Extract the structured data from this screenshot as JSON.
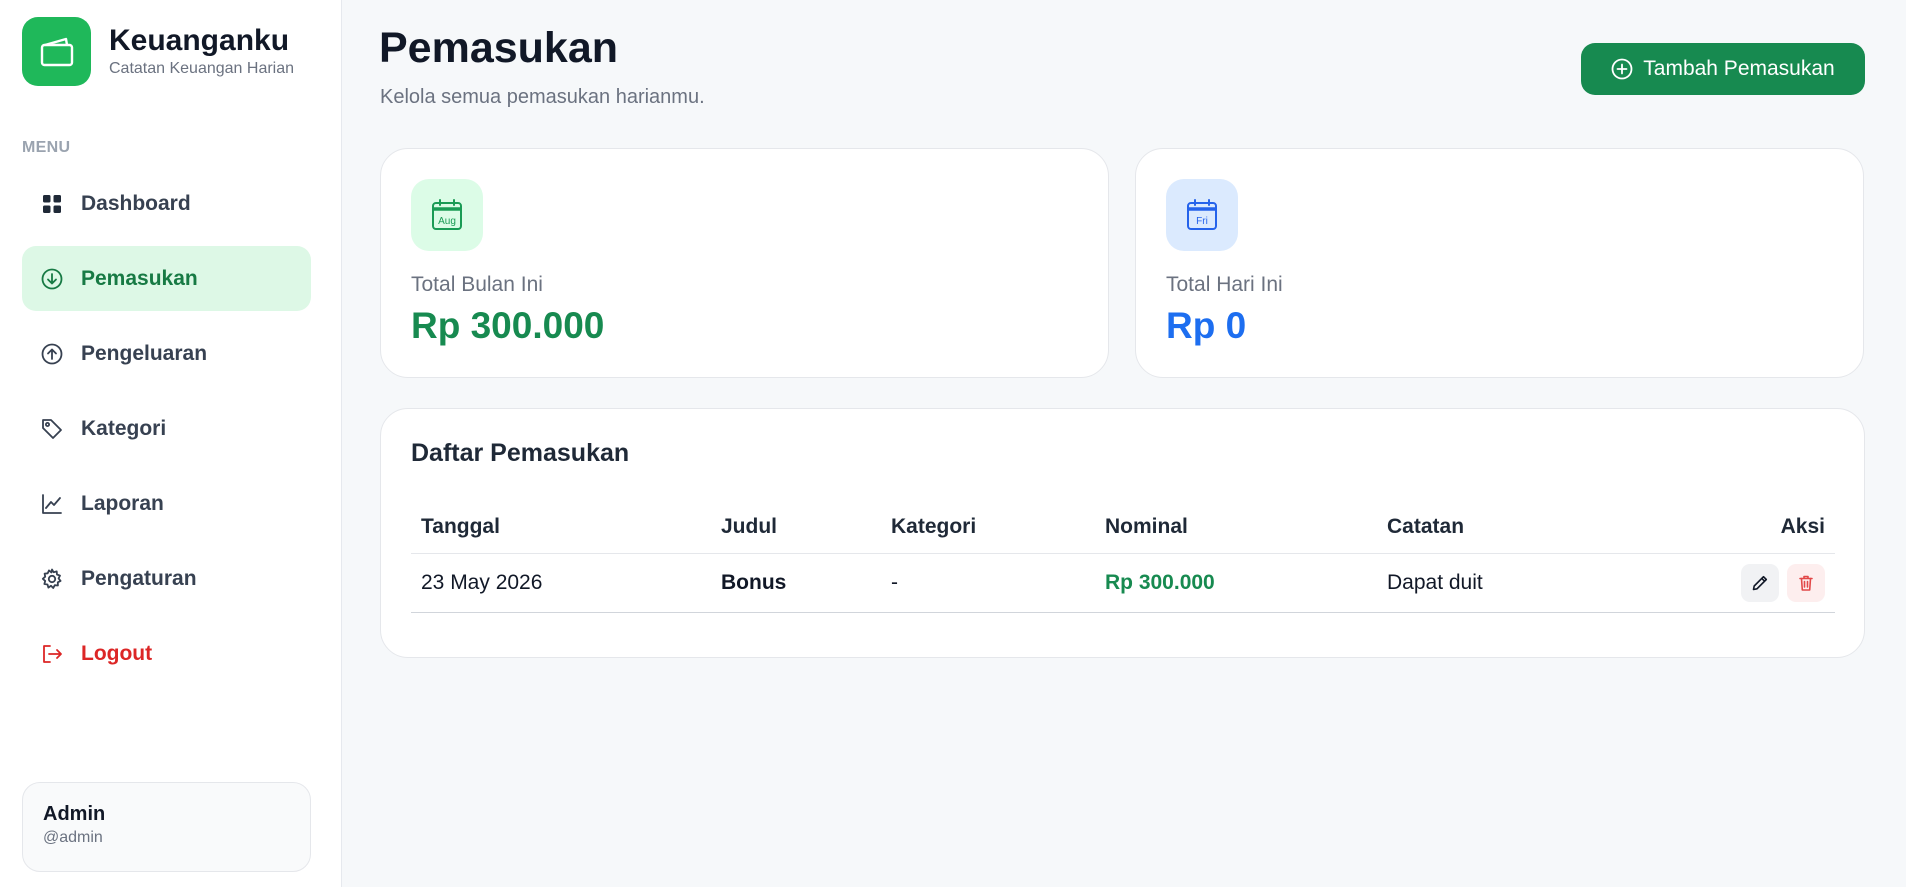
{
  "app": {
    "name": "Keuanganku",
    "tagline": "Catatan Keuangan Harian"
  },
  "sidebar": {
    "menu_heading": "MENU",
    "items": [
      {
        "label": "Dashboard",
        "icon": "grid-icon"
      },
      {
        "label": "Pemasukan",
        "icon": "arrow-down-circle-icon",
        "active": true
      },
      {
        "label": "Pengeluaran",
        "icon": "arrow-up-circle-icon"
      },
      {
        "label": "Kategori",
        "icon": "tag-icon"
      },
      {
        "label": "Laporan",
        "icon": "line-chart-icon"
      },
      {
        "label": "Pengaturan",
        "icon": "gear-icon"
      },
      {
        "label": "Logout",
        "icon": "logout-icon"
      }
    ],
    "user": {
      "name": "Admin",
      "handle": "@admin"
    }
  },
  "header": {
    "title": "Pemasukan",
    "subtitle": "Kelola semua pemasukan harianmu.",
    "add_button": "Tambah Pemasukan"
  },
  "stats": {
    "month": {
      "label": "Total Bulan Ini",
      "value": "Rp 300.000",
      "icon_text": "Aug"
    },
    "today": {
      "label": "Total Hari Ini",
      "value": "Rp 0",
      "icon_text": "Fri"
    }
  },
  "table": {
    "title": "Daftar Pemasukan",
    "columns": [
      "Tanggal",
      "Judul",
      "Kategori",
      "Nominal",
      "Catatan",
      "Aksi"
    ],
    "rows": [
      {
        "tanggal": "23 May 2026",
        "judul": "Bonus",
        "kategori": "-",
        "nominal": "Rp 300.000",
        "catatan": "Dapat duit"
      }
    ]
  },
  "colors": {
    "brand_green": "#1fb85a",
    "primary_green": "#178a50",
    "active_bg": "#ddf8e6",
    "blue": "#1d6ef0",
    "danger": "#dc2626"
  }
}
